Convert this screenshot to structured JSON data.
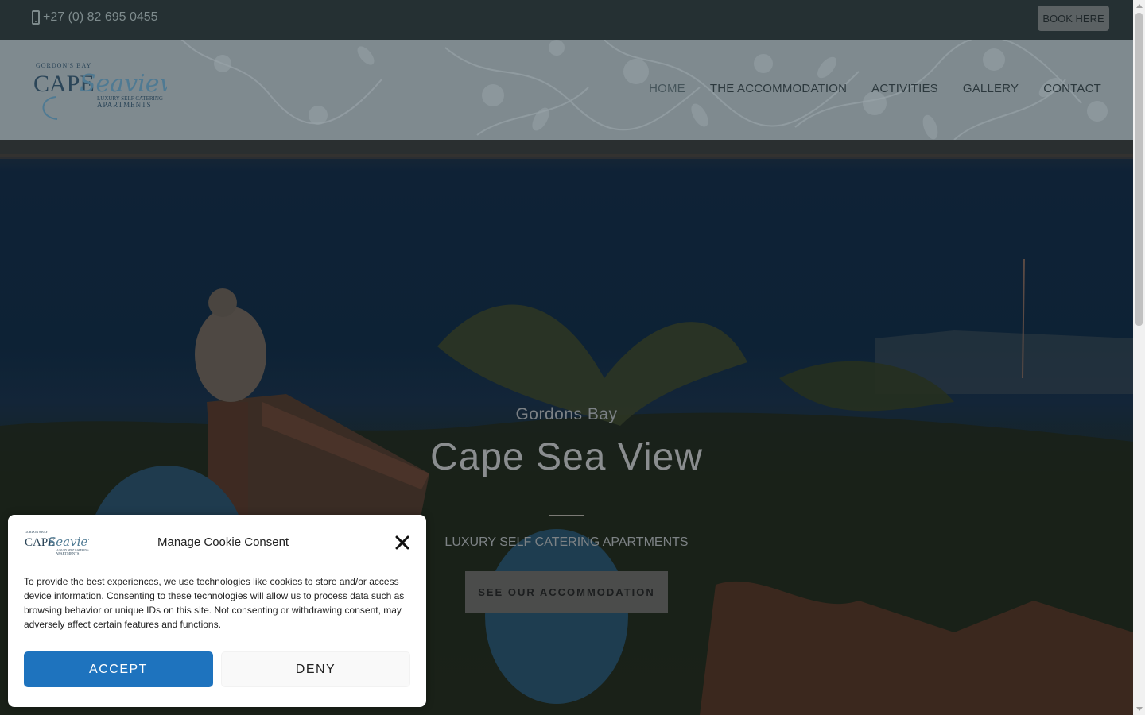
{
  "topbar": {
    "phone": "+27 (0) 82 695 0455",
    "book_label": "BOOK HERE"
  },
  "logo": {
    "line1": "GORDON'S BAY",
    "line2": "CAPE",
    "line3": "Seaview",
    "line4": "LUXURY SELF CATERING",
    "line5": "APARTMENTS"
  },
  "nav": {
    "items": [
      {
        "label": "HOME"
      },
      {
        "label": "THE ACCOMMODATION"
      },
      {
        "label": "ACTIVITIES"
      },
      {
        "label": "GALLERY"
      },
      {
        "label": "CONTACT"
      }
    ]
  },
  "hero": {
    "subtitle": "Gordons Bay",
    "title": "Cape Sea View",
    "tagline": "LUXURY SELF CATERING APARTMENTS",
    "cta_label": "SEE OUR ACCOMMODATION"
  },
  "cookie": {
    "title": "Manage Cookie Consent",
    "body": "To provide the best experiences, we use technologies like cookies to store and/or access device information. Consenting to these technologies will allow us to process data such as browsing behavior or unique IDs on this site. Not consenting or withdrawing consent, may adversely affect certain features and functions.",
    "accept_label": "ACCEPT",
    "deny_label": "DENY"
  },
  "colors": {
    "topbar_bg": "#253033",
    "accept_bg": "#1e73be",
    "hero_overlay": "#1b211b"
  }
}
